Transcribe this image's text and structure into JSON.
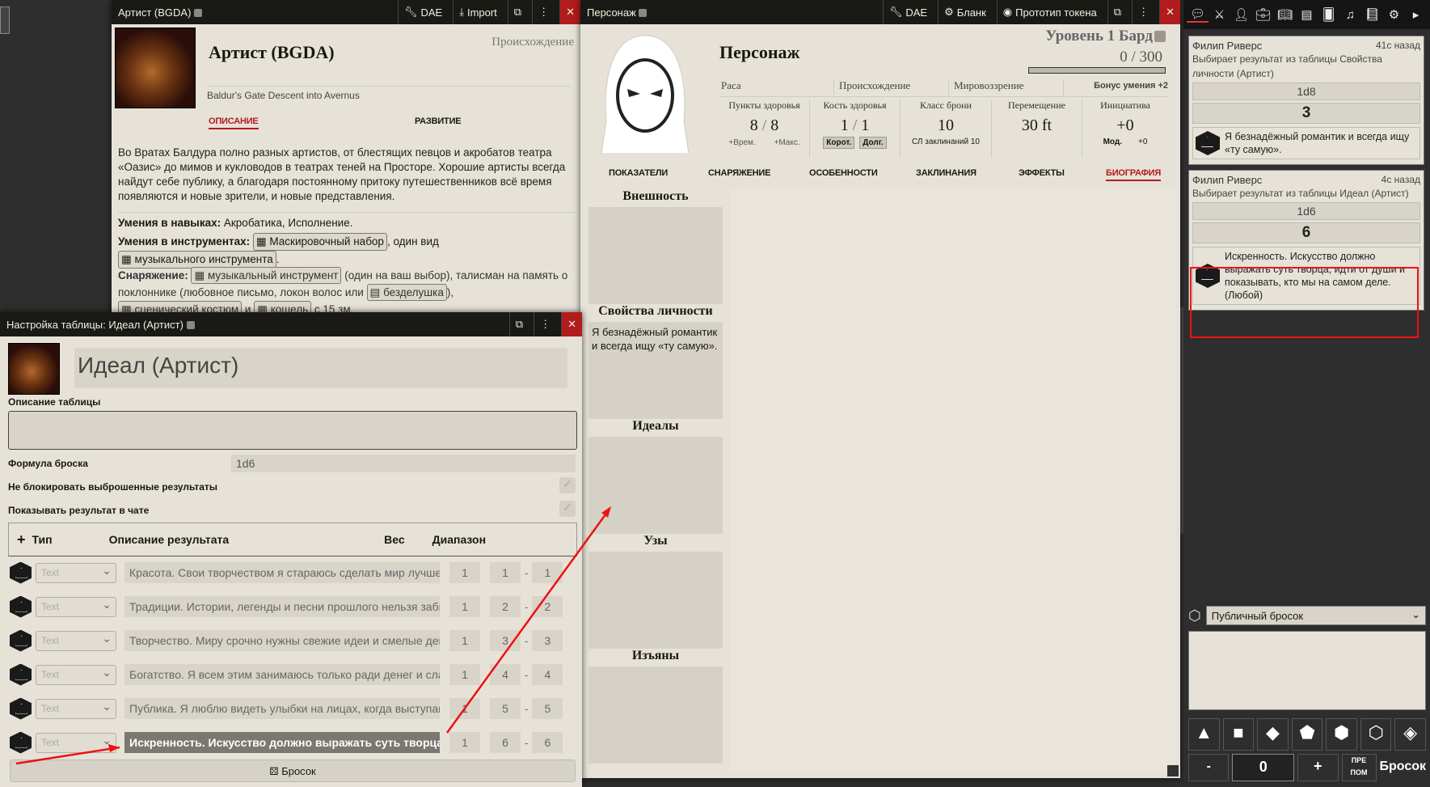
{
  "artist_window": {
    "title": "Артист (BGDA)",
    "dae": "DAE",
    "import": "Import",
    "name": "Артист (BGDA)",
    "type": "Происхождение",
    "source": "Baldur's Gate Descent into Avernus",
    "tabs": [
      "ОПИСАНИЕ",
      "РАЗВИТИЕ"
    ],
    "description": "Во Вратах Балдура полно разных артистов, от блестящих певцов и акробатов театра «Оазис» до мимов и кукловодов в театрах теней на Просторе. Хорошие артисты всегда найдут себе публику, а благодаря постоянному притоку путешественников всё время появляются и новые зрители, и новые представления.",
    "skills_label": "Умения в навыках:",
    "skills_value": "Акробатика, Исполнение.",
    "tools_label": "Умения в инструментах:",
    "tools_item1": "Маскировочный набор",
    "tools_mid": ", один вид",
    "tools_item2": "музыкального инструмента",
    "equip_label": "Снаряжение:",
    "equip_item1": "музыкальный инструмент",
    "equip_text1": "(один на ваш выбор), талисман на память о поклоннике (любовное письмо, локон волос или",
    "equip_item2": "безделушка",
    "equip_item3": "сценический костюм",
    "equip_and": "и",
    "equip_item4": "кошель",
    "equip_text2": "с 15 зм."
  },
  "table_window": {
    "title": "Настройка таблицы: Идеал (Артист)",
    "name": "Идеал (Артист)",
    "desc_label": "Описание таблицы",
    "formula_label": "Формула броска",
    "formula_value": "1d6",
    "no_lock_label": "Не блокировать выброшенные результаты",
    "show_chat_label": "Показывать результат в чате",
    "col_type": "Тип",
    "col_desc": "Описание результата",
    "col_weight": "Вес",
    "col_range": "Диапазон",
    "add_icon": "plus-icon",
    "rows": [
      {
        "type": "Text",
        "text": "Красота. Свои творчеством я стараюсь сделать мир лучше.",
        "weight": "1",
        "from": "1",
        "to": "1"
      },
      {
        "type": "Text",
        "text": "Традиции. Истории, легенды и песни прошлого нельзя забывать.",
        "weight": "1",
        "from": "2",
        "to": "2"
      },
      {
        "type": "Text",
        "text": "Творчество. Миру срочно нужны свежие идеи и смелые действия.",
        "weight": "1",
        "from": "3",
        "to": "3"
      },
      {
        "type": "Text",
        "text": "Богатство. Я всем этим занимаюсь только ради денег и славы.",
        "weight": "1",
        "from": "4",
        "to": "4"
      },
      {
        "type": "Text",
        "text": "Публика. Я люблю видеть улыбки на лицах, когда выступаю.",
        "weight": "1",
        "from": "5",
        "to": "5"
      },
      {
        "type": "Text",
        "text": "Искренность. Искусство должно выражать суть творца, идти от души",
        "weight": "1",
        "from": "6",
        "to": "6"
      }
    ],
    "roll_button": "Бросок"
  },
  "character_window": {
    "title": "Персонаж",
    "dae": "DAE",
    "blank": "Бланк",
    "token": "Прототип токена",
    "name": "Персонаж",
    "level": "Уровень 1 Бард",
    "xp_current": "0",
    "xp_sep": "/",
    "xp_max": "300",
    "race": "Раса",
    "background": "Происхождение",
    "alignment": "Мировоззрение",
    "prof_bonus": "Бонус умения +2",
    "hp_label": "Пункты здоровья",
    "hp_cur": "8",
    "hp_sep": "/",
    "hp_max": "8",
    "hp_temp": "+Врем.",
    "hp_tmax": "+Макс.",
    "hd_label": "Кость здоровья",
    "hd_cur": "1",
    "hd_sep": "/",
    "hd_max": "1",
    "hd_short": "Корот.",
    "hd_long": "Долг.",
    "ac_label": "Класс брони",
    "ac_value": "10",
    "spell_dc": "СЛ заклинаний 10",
    "move_label": "Перемещение",
    "move_value": "30 ft",
    "init_label": "Инициатива",
    "init_value": "+0",
    "init_mod": "Мод.",
    "init_mod_value": "+0",
    "tabs": [
      "ПОКАЗАТЕЛИ",
      "СНАРЯЖЕНИЕ",
      "ОСОБЕННОСТИ",
      "ЗАКЛИНАНИЯ",
      "ЭФФЕКТЫ",
      "БИОГРАФИЯ"
    ],
    "bio_sections": [
      {
        "title": "Внешность",
        "text": ""
      },
      {
        "title": "Свойства личности",
        "text": "Я безнадёжный романтик и всегда ищу «ту самую»."
      },
      {
        "title": "Идеалы",
        "text": ""
      },
      {
        "title": "Узы",
        "text": ""
      },
      {
        "title": "Изъяны",
        "text": ""
      }
    ]
  },
  "sidebar": {
    "tab_icons": [
      "chat-icon",
      "combat-icon",
      "actors-icon",
      "items-icon",
      "journal-icon",
      "tables-icon",
      "cards-icon",
      "playlists-icon",
      "compendium-icon",
      "settings-icon",
      "collapse-icon"
    ],
    "messages": [
      {
        "author": "Филип Риверс",
        "time": "41с назад",
        "flavor": "Выбирает результат из таблицы Свойства личности (Артист)",
        "formula": "1d8",
        "total": "3",
        "result": "Я безнадёжный романтик и всегда ищу «ту самую»."
      },
      {
        "author": "Филип Риверс",
        "time": "4с назад",
        "flavor": "Выбирает результат из таблицы Идеал (Артист)",
        "formula": "1d6",
        "total": "6",
        "result": "Искренность. Искусство должно выражать суть творца, идти от души и показывать, кто мы на самом деле. (Любой)"
      }
    ],
    "roll_mode": "Публичный бросок",
    "dice_buttons": [
      "d4-icon",
      "d6-icon",
      "d8-icon",
      "d10-icon",
      "d12-icon",
      "d20-icon",
      "d100-icon"
    ],
    "minus": "-",
    "modifier": "0",
    "plus": "+",
    "adv1": "ПРЕ",
    "adv2": "ПОМ",
    "roll": "Бросок"
  },
  "colors": {
    "accent_red": "#b21c1c",
    "parchment": "#e6e2d8",
    "header": "#191916"
  }
}
